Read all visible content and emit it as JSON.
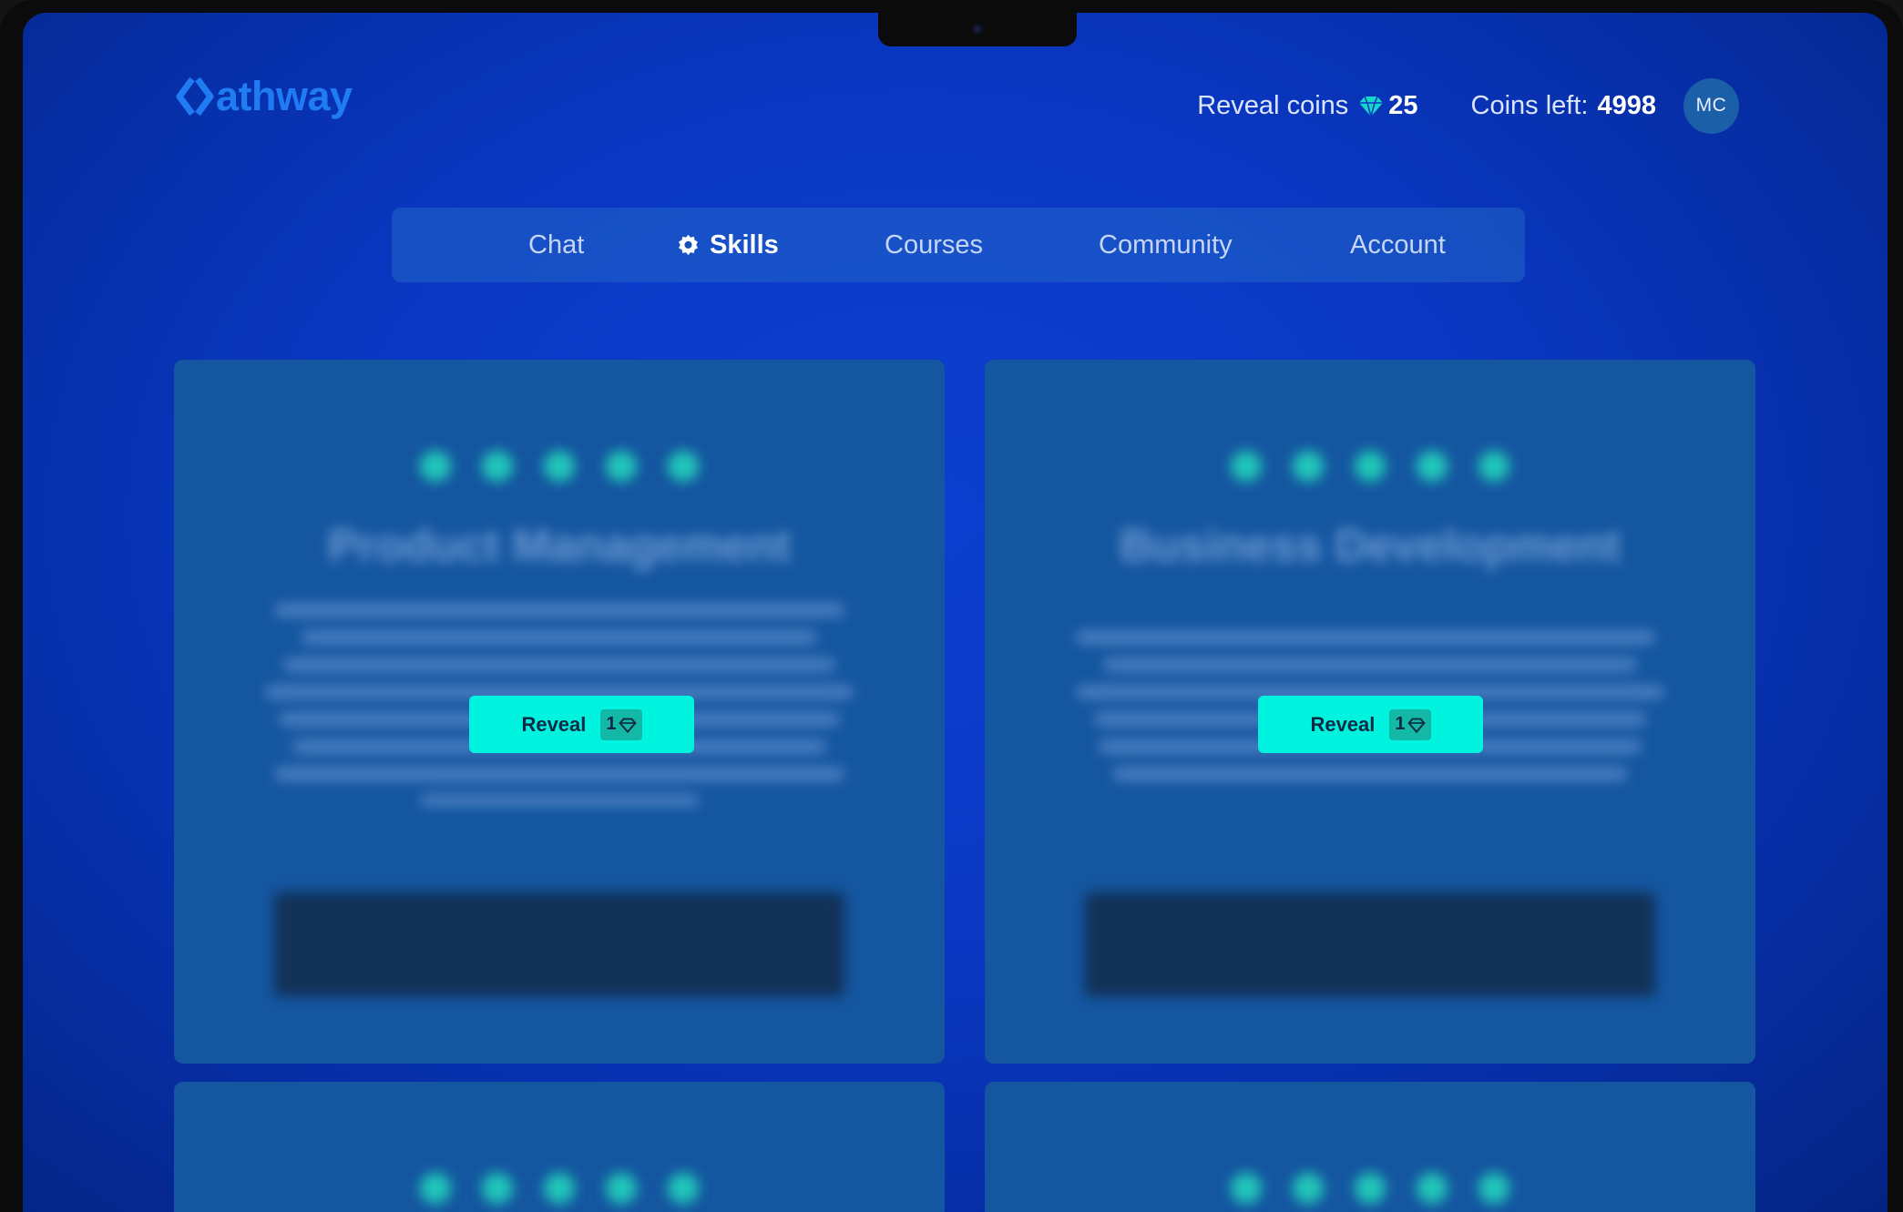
{
  "app": {
    "brand": "athway",
    "accent_color": "#1f7cf2",
    "reveal_color": "#00f3df"
  },
  "header": {
    "reveal_coins_label": "Reveal coins",
    "reveal_coins_icon": "gem-icon",
    "reveal_coins_value": "25",
    "coins_left_label": "Coins left:",
    "coins_left_value": "4998",
    "avatar_initials": "MC"
  },
  "nav": {
    "tabs": [
      {
        "label": "Chat",
        "active": false
      },
      {
        "label": "Skills",
        "active": true,
        "icon": "gear-icon"
      },
      {
        "label": "Courses",
        "active": false
      },
      {
        "label": "Community",
        "active": false
      },
      {
        "label": "Account",
        "active": false
      }
    ]
  },
  "cards": [
    {
      "title": "Product Management",
      "rating": 5,
      "reveal_label": "Reveal",
      "reveal_cost": "1",
      "blurred": true
    },
    {
      "title": "Business Development",
      "rating": 5,
      "reveal_label": "Reveal",
      "reveal_cost": "1",
      "blurred": true
    },
    {
      "rating": 5,
      "blurred": true
    },
    {
      "rating": 5,
      "blurred": true
    }
  ]
}
